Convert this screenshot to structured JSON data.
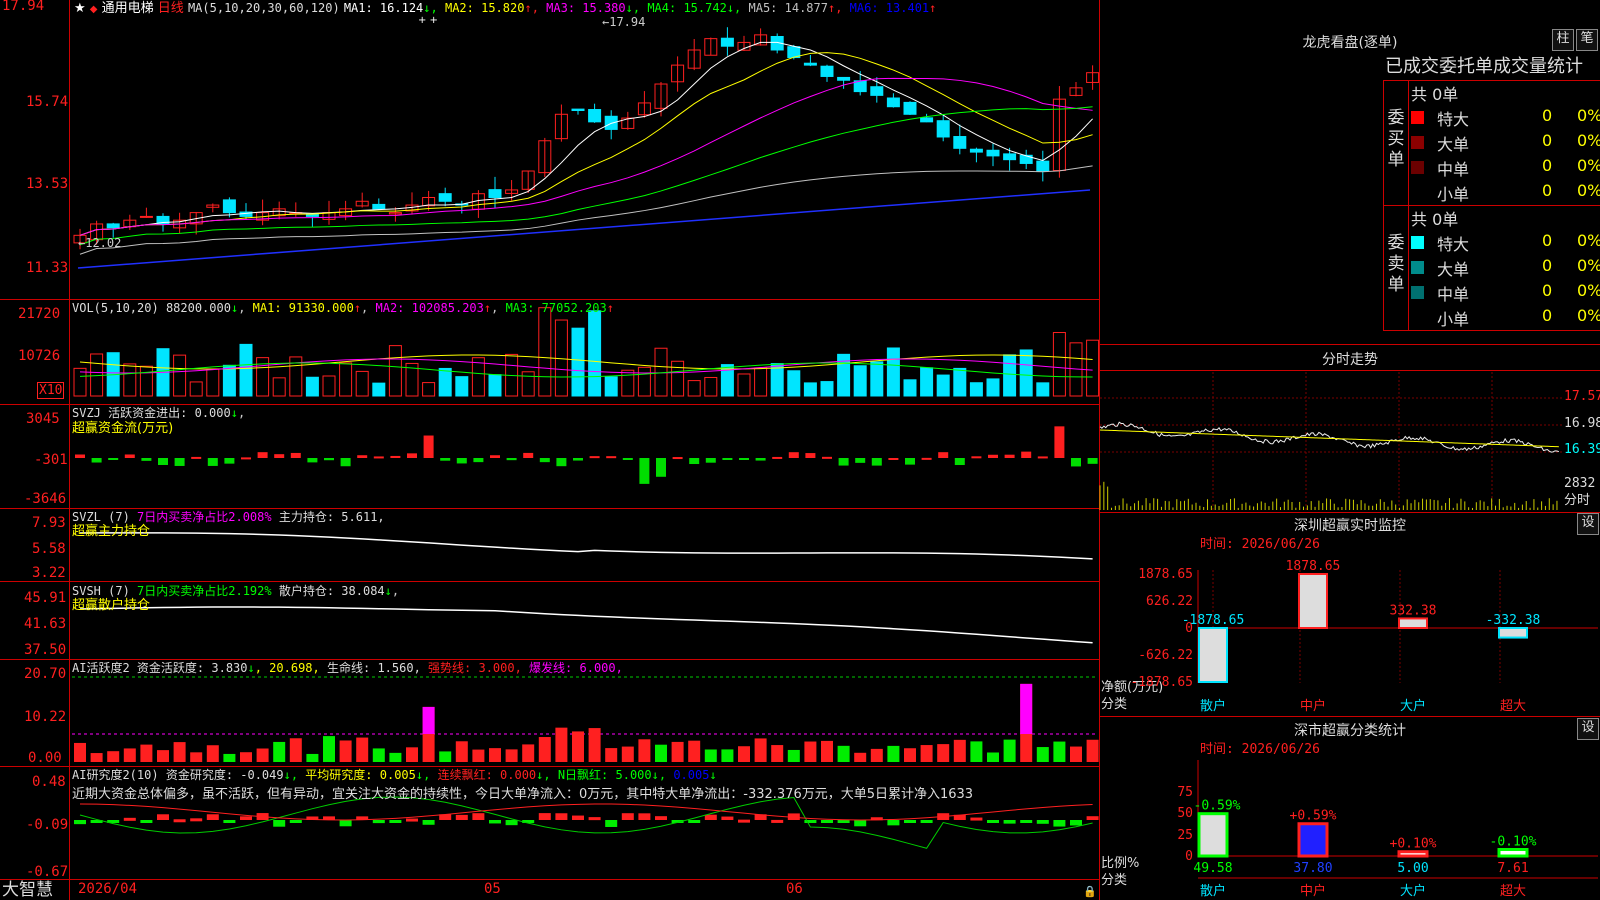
{
  "app": {
    "brand": "大智慧",
    "star": "★",
    "stock": "通用电梯",
    "period": "日线"
  },
  "colors": {
    "up": "#ff2020",
    "down": "#00e5ff",
    "ma1": "#ffffff",
    "ma2": "#ffff00",
    "ma3": "#ff00ff",
    "ma4": "#00ff00",
    "ma5": "#c0c0c0",
    "ma6": "#0000ff",
    "grid": "#cc0000"
  },
  "main_chart": {
    "ma_label": "MA(5,10,20,30,60,120)",
    "ma_items": [
      {
        "t": "MA1: 16.124",
        "a": "↓",
        "c": "#ffffff"
      },
      {
        "t": "MA2: 15.820",
        "a": "↑",
        "c": "#ffff00"
      },
      {
        "t": "MA3: 15.380",
        "a": "↓",
        "c": "#ff00ff"
      },
      {
        "t": "MA4: 15.742",
        "a": "↓",
        "c": "#00ff00"
      },
      {
        "t": "MA5: 14.877",
        "a": "↑",
        "c": "#c0c0c0"
      },
      {
        "t": "MA6: 13.401",
        "a": "↑",
        "c": "#0000ff"
      }
    ],
    "y_ticks": [
      "17.94",
      "15.74",
      "13.53",
      "11.33"
    ],
    "high_label": "17.94",
    "low_label": "12.02",
    "x_ticks": [
      "2026/04",
      "05",
      "06"
    ]
  },
  "vol_panel": {
    "title": "VOL(5,10,20)",
    "value": "88200.000",
    "value_arrow": "↓",
    "ma1": "MA1: 91330.000",
    "ma1_arrow": "↑",
    "ma2": "MA2: 102085.203",
    "ma2_arrow": "↑",
    "ma3": "MA3: 77052.203",
    "ma3_arrow": "↑",
    "y_ticks": [
      "21720",
      "10726"
    ],
    "unit": "X10"
  },
  "svzj_panel": {
    "title": "SVZJ",
    "label": "活跃资金进出: 0.000",
    "arrow": "↓",
    "subtitle": "超赢资金流(万元)",
    "y_ticks": [
      "3045",
      "-301",
      "-3646"
    ]
  },
  "svzl_panel": {
    "title": "SVZL (7)",
    "ratio": "7日内买卖净占比2.008%",
    "hold": "主力持仓: 5.611,",
    "subtitle": "超赢主力持仓",
    "y_ticks": [
      "7.93",
      "5.58",
      "3.22"
    ]
  },
  "svsh_panel": {
    "title": "SVSH (7)",
    "ratio": "7日内买卖净占比2.192%",
    "hold": "散户持仓: 38.084",
    "arrow": "↓",
    "subtitle": "超赢散户持仓",
    "y_ticks": [
      "45.91",
      "41.63",
      "37.50"
    ]
  },
  "ai_active": {
    "title": "AI活跃度2",
    "items": [
      {
        "t": "资金活跃度: 3.830",
        "c": "#dddddd"
      },
      {
        "t": "↓",
        "c": "#00ff00"
      },
      {
        "t": ", 20.698,",
        "c": "#ffff00"
      },
      {
        "t": " 生命线: 1.560,",
        "c": "#dddddd"
      },
      {
        "t": " 强势线: 3.000,",
        "c": "#ff2020"
      },
      {
        "t": " 爆发线: 6.000,",
        "c": "#ff00ff"
      }
    ],
    "y_ticks": [
      "20.70",
      "10.22",
      "0.00"
    ]
  },
  "ai_research": {
    "title": "AI研究度2(10)",
    "items": [
      {
        "t": "资金研究度: -0.049",
        "c": "#dddddd"
      },
      {
        "t": "↓,",
        "c": "#00ff00"
      },
      {
        "t": " 平均研究度: 0.005",
        "c": "#ffff00"
      },
      {
        "t": "↓,",
        "c": "#00ff00"
      },
      {
        "t": " 连续飘红: 0.000",
        "c": "#ff2020"
      },
      {
        "t": "↓,",
        "c": "#00ff00"
      },
      {
        "t": " N日飘红: 5.000",
        "c": "#00ff00"
      },
      {
        "t": "↓,",
        "c": "#00ff00"
      },
      {
        "t": " 0.005",
        "c": "#0000ff"
      },
      {
        "t": "↓",
        "c": "#00ff00"
      }
    ],
    "comment": "近期大资金总体偏多，虽不活跃，但有异动，宜关注大资金的持续性，今日大单净流入：0万元，其中特大单净流出：-332.376万元，大单5日累计净入1633",
    "y_ticks": [
      "0.48",
      "-0.09",
      "-0.67"
    ]
  },
  "right_panel": {
    "dragon": {
      "title": "龙虎看盘(逐单)",
      "btn1": "柱",
      "btn2": "笔",
      "subtitle": "已成交委托单成交量统计",
      "buy": {
        "label": "委买单",
        "total": "共 0单",
        "rows": [
          {
            "n": "特大",
            "v": "0",
            "p": "0%",
            "c": "#ff0000"
          },
          {
            "n": "大单",
            "v": "0",
            "p": "0%",
            "c": "#8b0000"
          },
          {
            "n": "中单",
            "v": "0",
            "p": "0%",
            "c": "#6b0000"
          },
          {
            "n": "小单",
            "v": "0",
            "p": "0%",
            "c": "#000000"
          }
        ]
      },
      "sell": {
        "label": "委卖单",
        "total": "共 0单",
        "rows": [
          {
            "n": "特大",
            "v": "0",
            "p": "0%",
            "c": "#00ffff"
          },
          {
            "n": "大单",
            "v": "0",
            "p": "0%",
            "c": "#008b8b"
          },
          {
            "n": "中单",
            "v": "0",
            "p": "0%",
            "c": "#007070"
          },
          {
            "n": "小单",
            "v": "0",
            "p": "0%",
            "c": "#000000"
          }
        ]
      }
    },
    "intraday": {
      "title": "分时走势",
      "y_ticks": [
        "17.57",
        "16.98",
        "16.39"
      ],
      "vol_tick": "2832",
      "vol_label": "分时"
    },
    "monitor": {
      "title": "深圳超赢实时监控",
      "btn": "设",
      "time": "时间: 2026/06/26",
      "y_ticks": [
        "1878.65",
        "626.22",
        "0",
        "-626.22",
        "-1878.65"
      ],
      "side_label": "净额(万元)",
      "side_label2": "分类",
      "bars": [
        {
          "cat": "散户",
          "val": -1878.65,
          "label": "-1878.65"
        },
        {
          "cat": "中户",
          "val": 1878.65,
          "label": "1878.65"
        },
        {
          "cat": "大户",
          "val": 332.38,
          "label": "332.38"
        },
        {
          "cat": "超大",
          "val": -332.38,
          "label": "-332.38"
        }
      ]
    },
    "classify": {
      "title": "深市超赢分类统计",
      "btn": "设",
      "time": "时间: 2026/06/26",
      "y_ticks": [
        "75",
        "50",
        "25",
        "0"
      ],
      "side_label": "比例%",
      "side_label2": "分类",
      "bars": [
        {
          "cat": "散户",
          "val": 49.58,
          "label": "49.58",
          "delta": "-0.59%",
          "dc": "#00ff00"
        },
        {
          "cat": "中户",
          "val": 37.8,
          "label": "37.80",
          "delta": "+0.59%",
          "dc": "#ff2020"
        },
        {
          "cat": "大户",
          "val": 5.0,
          "label": "5.00",
          "delta": "+0.10%",
          "dc": "#ff2020"
        },
        {
          "cat": "超大",
          "val": 7.61,
          "label": "7.61",
          "delta": "-0.10%",
          "dc": "#00ff00"
        }
      ]
    }
  }
}
